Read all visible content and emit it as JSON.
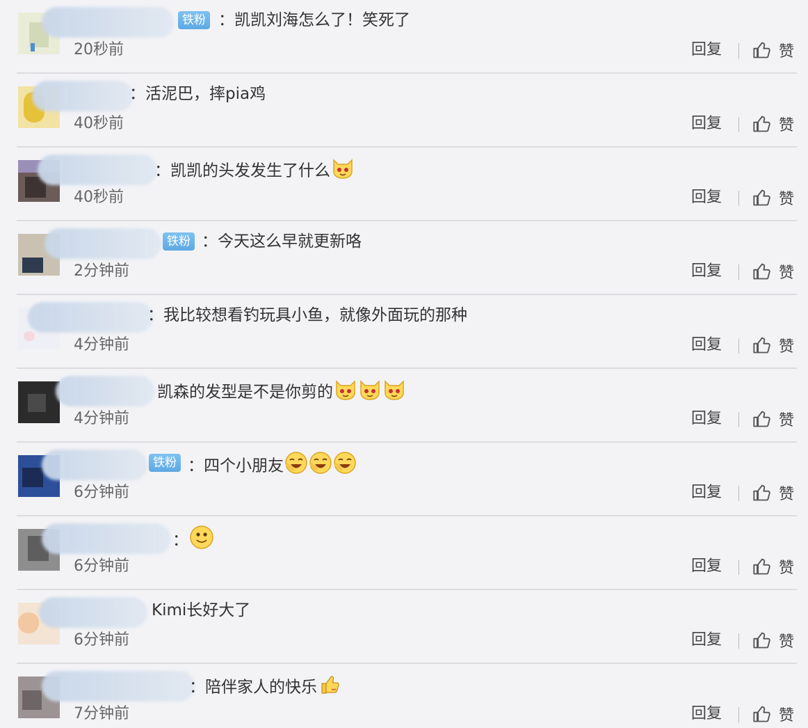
{
  "comments": [
    {
      "badge": "铁粉",
      "text": "：凯凯刘海怎么了！笑死了",
      "emojis": [],
      "time": "20秒前"
    },
    {
      "badge": "",
      "text": "：活泥巴，摔pia鸡",
      "emojis": [],
      "time": "40秒前"
    },
    {
      "badge": "",
      "text": "：凯凯的头发发生了什么",
      "emojis": [
        "cat-face-emoji"
      ],
      "time": "40秒前"
    },
    {
      "badge": "铁粉",
      "text": "：今天这么早就更新咯",
      "emojis": [],
      "time": "2分钟前"
    },
    {
      "badge": "",
      "text": "：我比较想看钓玩具小鱼，就像外面玩的那种",
      "emojis": [],
      "time": "4分钟前"
    },
    {
      "badge": "",
      "text": "凯森的发型是不是你剪的",
      "emojis": [
        "cat-face-emoji",
        "cat-face-emoji",
        "cat-face-emoji"
      ],
      "time": "4分钟前"
    },
    {
      "badge": "铁粉",
      "text": "：四个小朋友",
      "emojis": [
        "laughing-face-emoji",
        "laughing-face-emoji",
        "laughing-face-emoji"
      ],
      "time": "6分钟前"
    },
    {
      "badge": "",
      "text": "：",
      "emojis": [
        "smile-face-emoji"
      ],
      "time": "6分钟前"
    },
    {
      "badge": "",
      "text": "Kimi长好大了",
      "emojis": [],
      "time": "6分钟前"
    },
    {
      "badge": "",
      "text": "：陪伴家人的快乐",
      "emojis": [
        "thumbs-up-emoji"
      ],
      "time": "7分钟前"
    }
  ],
  "actions": {
    "reply_label": "回复",
    "like_label": "赞",
    "like_icon": "thumbs-up-icon"
  },
  "colors": {
    "badge": "#5ea9e3",
    "background": "#f3f3f6",
    "divider": "#dcdce0"
  }
}
